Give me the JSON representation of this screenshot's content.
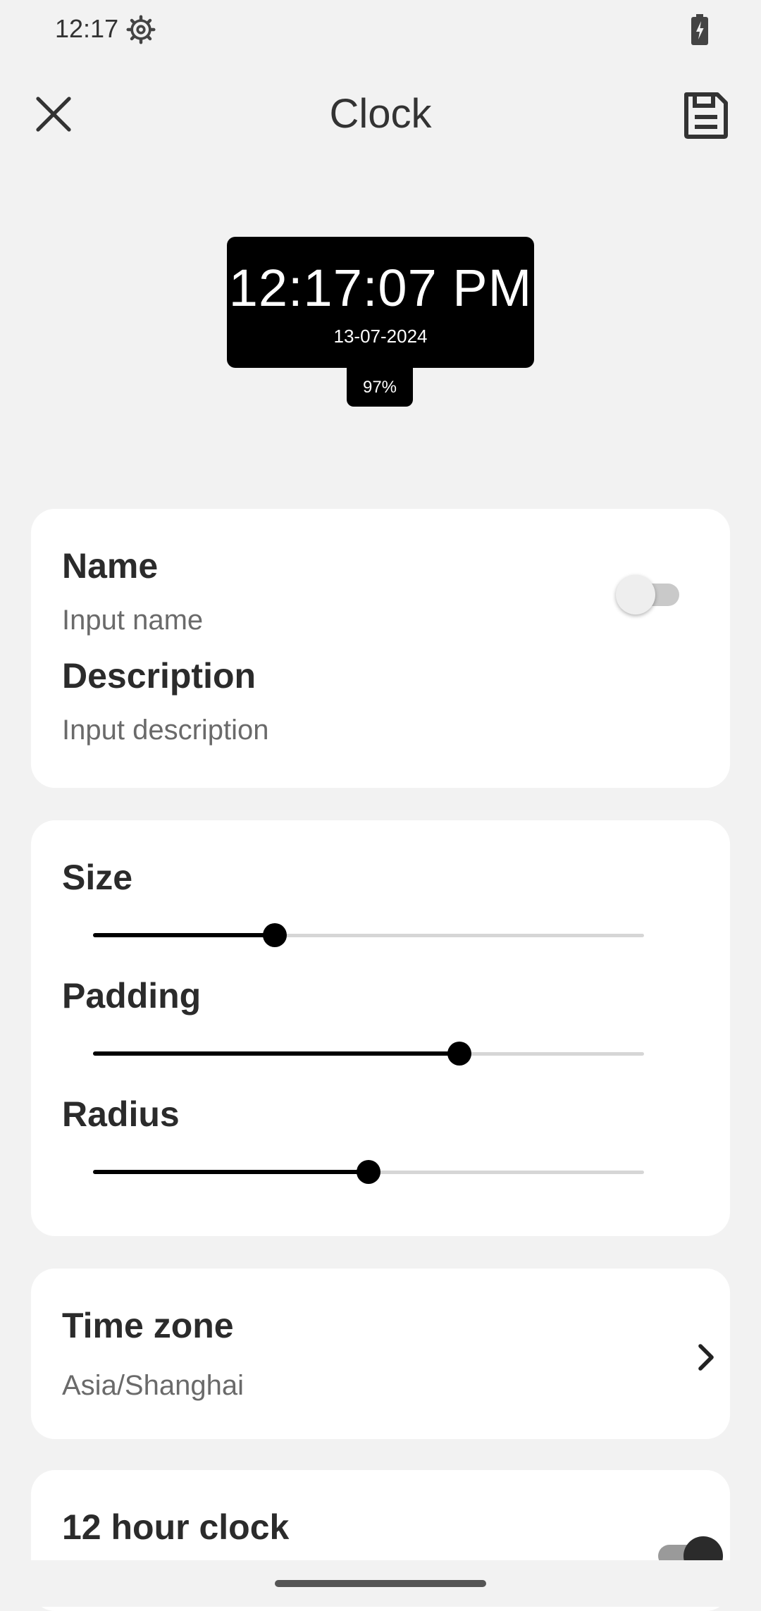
{
  "status_bar": {
    "time": "12:17"
  },
  "app_bar": {
    "title": "Clock"
  },
  "preview": {
    "time": "12:17:07 PM",
    "date": "13-07-2024",
    "battery": "97%"
  },
  "info_card": {
    "name_label": "Name",
    "name_placeholder": "Input name",
    "description_label": "Description",
    "description_placeholder": "Input description",
    "toggle_on": false
  },
  "style_card": {
    "size_label": "Size",
    "size_value": 0.33,
    "padding_label": "Padding",
    "padding_value": 0.665,
    "radius_label": "Radius",
    "radius_value": 0.5
  },
  "timezone_card": {
    "label": "Time zone",
    "value": "Asia/Shanghai"
  },
  "hour_card": {
    "label": "12 hour clock",
    "toggle_on": true
  },
  "colors": {
    "accent": "#000000",
    "background": "#f2f2f2",
    "card": "#ffffff"
  }
}
